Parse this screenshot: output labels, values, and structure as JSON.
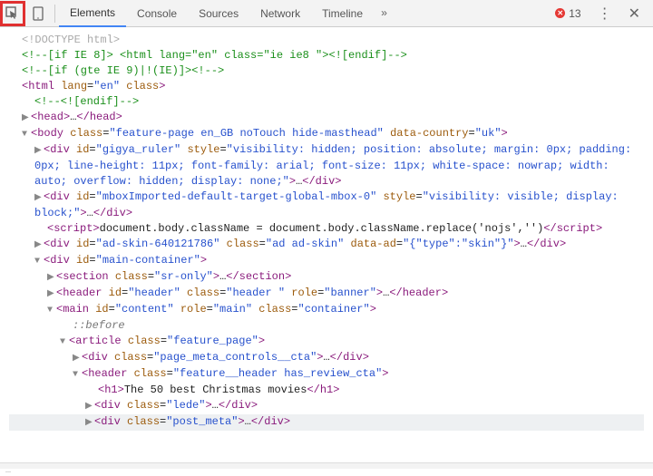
{
  "toolbar": {
    "tabs": [
      "Elements",
      "Console",
      "Sources",
      "Network",
      "Timeline"
    ],
    "more": "»",
    "error_count": "13",
    "menu": "⋮",
    "close": "✕"
  },
  "lines": {
    "l0": "<!DOCTYPE html>",
    "l1_a": "<!--[if IE 8]> <html lang=\"en\"  class=\"ie ie8 \"><![endif]-->",
    "l2_a": "<!--[if (gte IE 9)|!(IE)]><!-->",
    "l3_open": "<",
    "l3_tag": "html",
    "l3_attr1": " lang",
    "l3_eq": "=",
    "l3_val1": "\"en\"",
    "l3_attr2": " class",
    "l3_close": ">",
    "l4": "<!--<![endif]-->",
    "l5_open": "<",
    "l5_tag": "head",
    "l5_close": ">",
    "l5_ell": "…",
    "l5_end": "</",
    "l5_endclose": ">",
    "l6_open": "<",
    "l6_tag": "body",
    "l6_attr1": " class",
    "l6_val1": "\"feature-page   en_GB noTouch hide-masthead\"",
    "l6_attr2": " data-country",
    "l6_val2": "\"uk\"",
    "l6_close": ">",
    "l7_open": "<",
    "l7_tag": "div",
    "l7_attr1": " id",
    "l7_val1": "\"gigya_ruler\"",
    "l7_attr2": " style",
    "l7_val2": "\"visibility: hidden; position: absolute; margin: 0px; padding: 0px; line-height: 11px; font-family: arial; font-size: 11px; white-space: nowrap; width: auto; overflow: hidden; display: none;\"",
    "l7_close": ">",
    "l7_ell": "…",
    "l7_end": "</",
    "l7_endclose": ">",
    "l8_open": "<",
    "l8_tag": "div",
    "l8_attr1": " id",
    "l8_val1": "\"mboxImported-default-target-global-mbox-0\"",
    "l8_attr2": " style",
    "l8_val2": "\"visibility: visible; display: block;\"",
    "l8_close": ">",
    "l8_ell": "…",
    "l8_end": "</",
    "l8_endclose": ">",
    "l9_open": "<",
    "l9_tag": "script",
    "l9_close": ">",
    "l9_txt": "document.body.className = document.body.className.replace('nojs','')",
    "l9_end": "</",
    "l9_endclose": ">",
    "l10_open": "<",
    "l10_tag": "div",
    "l10_attr1": " id",
    "l10_val1": "\"ad-skin-640121786\"",
    "l10_attr2": " class",
    "l10_val2": "\"ad  ad-skin\"",
    "l10_attr3": " data-ad",
    "l10_val3": "\"{\"type\":\"skin\"}\"",
    "l10_close": ">",
    "l10_ell": "…",
    "l10_end": "</",
    "l10_endclose": ">",
    "l11_open": "<",
    "l11_tag": "div",
    "l11_attr1": " id",
    "l11_val1": "\"main-container\"",
    "l11_close": ">",
    "l12_open": "<",
    "l12_tag": "section",
    "l12_attr1": " class",
    "l12_val1": "\"sr-only\"",
    "l12_close": ">",
    "l12_ell": "…",
    "l12_end": "</",
    "l12_endclose": ">",
    "l13_open": "<",
    "l13_tag": "header",
    "l13_attr1": " id",
    "l13_val1": "\"header\"",
    "l13_attr2": " class",
    "l13_val2": "\"header \"",
    "l13_attr3": " role",
    "l13_val3": "\"banner\"",
    "l13_close": ">",
    "l13_ell": "…",
    "l13_end": "</",
    "l13_endclose": ">",
    "l14_open": "<",
    "l14_tag": "main",
    "l14_attr1": " id",
    "l14_val1": "\"content\"",
    "l14_attr2": " role",
    "l14_val2": "\"main\"",
    "l14_attr3": " class",
    "l14_val3": "\"container\"",
    "l14_close": ">",
    "l15": "::before",
    "l16_open": "<",
    "l16_tag": "article",
    "l16_attr1": " class",
    "l16_val1": "\"feature_page\"",
    "l16_close": ">",
    "l17_open": "<",
    "l17_tag": "div",
    "l17_attr1": " class",
    "l17_val1": "\"page_meta_controls__cta\"",
    "l17_close": ">",
    "l17_ell": "…",
    "l17_end": "</",
    "l17_endclose": ">",
    "l18_open": "<",
    "l18_tag": "header",
    "l18_attr1": " class",
    "l18_val1": "\"feature__header has_review_cta\"",
    "l18_close": ">",
    "l19_open": "<",
    "l19_tag": "h1",
    "l19_close": ">",
    "l19_txt": "The 50 best Christmas movies",
    "l19_end": "</",
    "l19_endclose": ">",
    "l20_open": "<",
    "l20_tag": "div",
    "l20_attr1": " class",
    "l20_val1": "\"lede\"",
    "l20_close": ">",
    "l20_ell": "…",
    "l20_end": "</",
    "l20_endclose": ">",
    "l21_open": "<",
    "l21_tag": "div",
    "l21_attr1": " class",
    "l21_val1": "\"post_meta\"",
    "l21_close": ">",
    "l21_ell": "…",
    "l21_end": "</",
    "l21_endclose": ">"
  },
  "tri_right": "▶",
  "tri_down": "▼"
}
